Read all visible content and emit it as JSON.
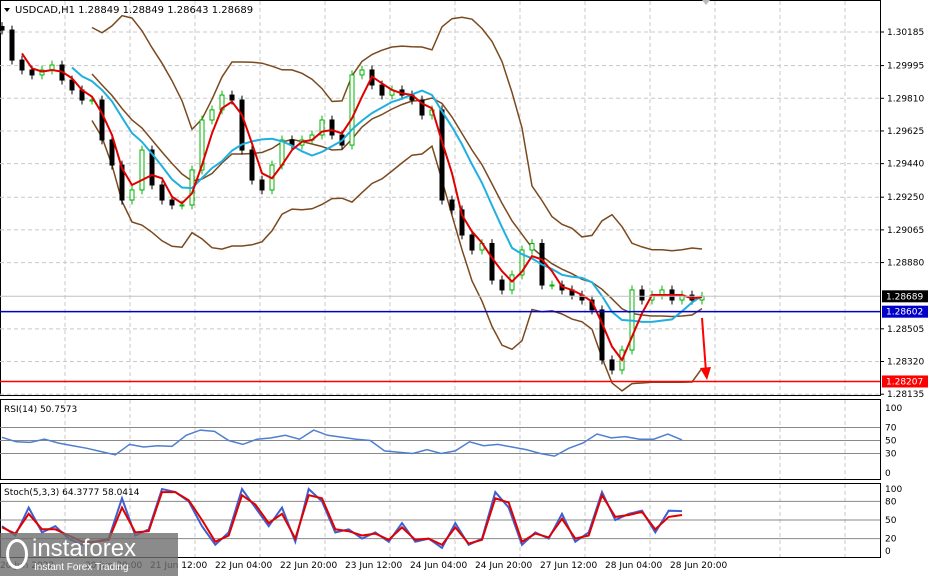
{
  "chart_data": {
    "type": "candlestick",
    "title": "USDCAD,H1  1.28849 1.28849 1.28643 1.28689",
    "y_ticks": [
      "1.30185",
      "1.29995",
      "1.29810",
      "1.29625",
      "1.29440",
      "1.29250",
      "1.29065",
      "1.28880",
      "1.28505",
      "1.28320",
      "1.28135"
    ],
    "ylim": [
      1.2812,
      1.3032
    ],
    "current_price": "1.28689",
    "levels": [
      {
        "label": "1.28602",
        "value": 1.28602,
        "color": "#0000c8"
      },
      {
        "label": "1.28207",
        "value": 1.28207,
        "color": "#ff0000"
      }
    ],
    "x_ticks": [
      "20 Jun 2022",
      "20 Jun 20:00",
      "21 Jun 12:00",
      "22 Jun 04:00",
      "22 Jun 20:00",
      "23 Jun 12:00",
      "24 Jun 04:00",
      "24 Jun 20:00",
      "27 Jun 12:00",
      "28 Jun 04:00",
      "28 Jun 20:00"
    ],
    "closes": [
      1.30196,
      1.30026,
      1.2997,
      1.29942,
      1.2997,
      1.29998,
      1.29913,
      1.29857,
      1.298,
      1.298,
      1.29574,
      1.29432,
      1.29234,
      1.29291,
      1.29517,
      1.29319,
      1.29234,
      1.29206,
      1.29206,
      1.29404,
      1.29687,
      1.29744,
      1.29828,
      1.298,
      1.29517,
      1.29347,
      1.29291,
      1.29432,
      1.29574,
      1.29545,
      1.29574,
      1.29602,
      1.29687,
      1.29602,
      1.29545,
      1.29942,
      1.2997,
      1.29885,
      1.29828,
      1.29857,
      1.29828,
      1.298,
      1.29715,
      1.29744,
      1.29234,
      1.29178,
      1.29036,
      1.28951,
      1.28988,
      1.28781,
      1.28725,
      1.2881,
      1.28951,
      1.28988,
      1.28753,
      1.28753,
      1.28725,
      1.28696,
      1.28668,
      1.28612,
      1.28329,
      1.28272,
      1.28385,
      1.28725,
      1.28668,
      1.28696,
      1.28725,
      1.28668,
      1.28696,
      1.28668,
      1.28689
    ],
    "colors": {
      "bull": "#00b400",
      "bear": "#000000",
      "fast_ma": "#e00000",
      "slow_ma": "#20b0e0",
      "bands": "#7a4a1e",
      "arrow": "#ff0000"
    },
    "rsi": {
      "label": "RSI(14) 50.7573",
      "ticks": [
        "100",
        "70",
        "50",
        "30",
        "0"
      ],
      "levels": [
        70,
        50,
        30
      ],
      "values": [
        55,
        48,
        47,
        52,
        46,
        42,
        38,
        33,
        28,
        44,
        40,
        42,
        41,
        58,
        66,
        64,
        50,
        44,
        52,
        54,
        58,
        52,
        66,
        58,
        55,
        52,
        50,
        34,
        32,
        30,
        36,
        30,
        34,
        48,
        42,
        44,
        40,
        36,
        30,
        26,
        38,
        46,
        60,
        54,
        56,
        52,
        52,
        60,
        51
      ]
    },
    "stoch": {
      "label": "Stoch(5,3,3) 64.3777 58.0414",
      "ticks": [
        "100",
        "80",
        "50",
        "20",
        "0"
      ],
      "levels": [
        80,
        50,
        20
      ],
      "main": [
        40,
        25,
        70,
        30,
        40,
        20,
        10,
        15,
        20,
        85,
        25,
        35,
        100,
        95,
        80,
        40,
        10,
        30,
        100,
        70,
        40,
        70,
        15,
        100,
        80,
        30,
        35,
        20,
        30,
        15,
        45,
        15,
        20,
        5,
        45,
        10,
        20,
        95,
        70,
        10,
        30,
        20,
        60,
        15,
        30,
        95,
        50,
        60,
        65,
        30,
        65,
        64.38
      ],
      "signal": [
        38,
        28,
        60,
        35,
        35,
        25,
        15,
        15,
        18,
        70,
        30,
        32,
        95,
        95,
        82,
        50,
        15,
        25,
        90,
        75,
        45,
        60,
        20,
        90,
        85,
        35,
        32,
        25,
        28,
        18,
        38,
        18,
        20,
        10,
        38,
        12,
        18,
        85,
        78,
        15,
        28,
        22,
        52,
        20,
        25,
        90,
        55,
        58,
        63,
        35,
        55,
        58.04
      ]
    }
  },
  "watermark": {
    "brand": "instaforex",
    "tagline": "Instant Forex Trading"
  }
}
